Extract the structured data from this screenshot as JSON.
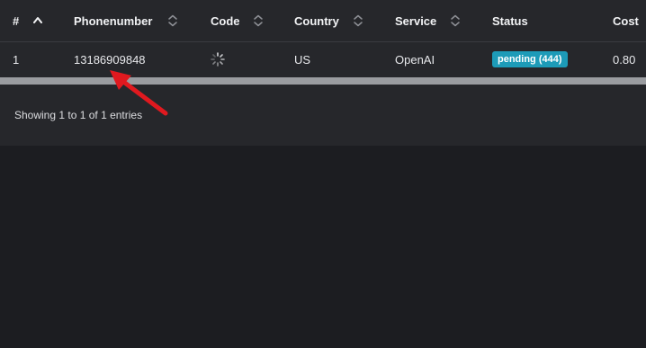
{
  "table": {
    "columns": [
      {
        "label": "#"
      },
      {
        "label": "Phonenumber"
      },
      {
        "label": "Code"
      },
      {
        "label": "Country"
      },
      {
        "label": "Service"
      },
      {
        "label": "Status"
      },
      {
        "label": "Cost"
      }
    ],
    "rows": [
      {
        "index": "1",
        "phonenumber": "13186909848",
        "code_icon": "loading-spinner-icon",
        "country": "US",
        "service": "OpenAI",
        "status": "pending (444)",
        "cost": "0.80"
      }
    ]
  },
  "footer": {
    "info_text": "Showing 1 to 1 of 1 entries"
  },
  "colors": {
    "status_badge": "#1d9bb8",
    "annotation_arrow": "#e0191f",
    "panel_background": "#26272b",
    "page_background": "#1c1d21"
  }
}
